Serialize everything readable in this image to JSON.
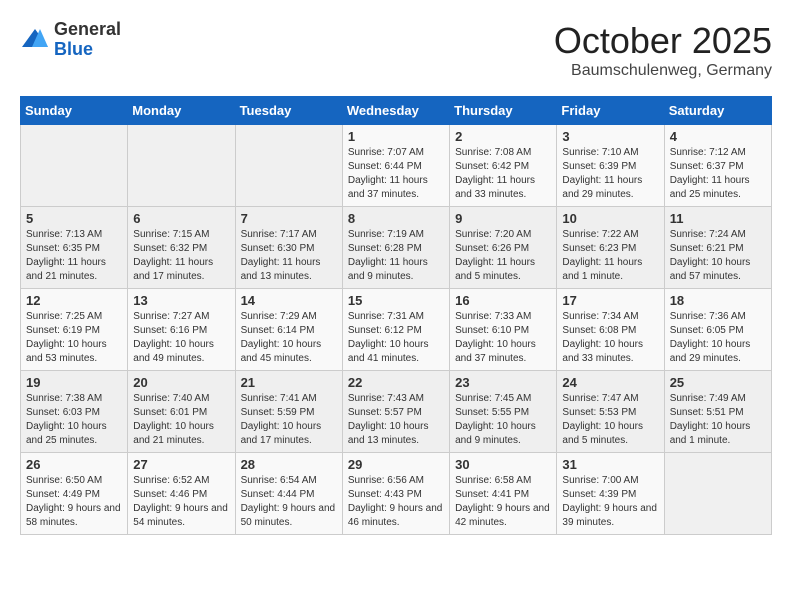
{
  "header": {
    "logo_general": "General",
    "logo_blue": "Blue",
    "title": "October 2025",
    "subtitle": "Baumschulenweg, Germany"
  },
  "days_of_week": [
    "Sunday",
    "Monday",
    "Tuesday",
    "Wednesday",
    "Thursday",
    "Friday",
    "Saturday"
  ],
  "weeks": [
    [
      {
        "day": "",
        "info": ""
      },
      {
        "day": "",
        "info": ""
      },
      {
        "day": "",
        "info": ""
      },
      {
        "day": "1",
        "info": "Sunrise: 7:07 AM\nSunset: 6:44 PM\nDaylight: 11 hours\nand 37 minutes."
      },
      {
        "day": "2",
        "info": "Sunrise: 7:08 AM\nSunset: 6:42 PM\nDaylight: 11 hours\nand 33 minutes."
      },
      {
        "day": "3",
        "info": "Sunrise: 7:10 AM\nSunset: 6:39 PM\nDaylight: 11 hours\nand 29 minutes."
      },
      {
        "day": "4",
        "info": "Sunrise: 7:12 AM\nSunset: 6:37 PM\nDaylight: 11 hours\nand 25 minutes."
      }
    ],
    [
      {
        "day": "5",
        "info": "Sunrise: 7:13 AM\nSunset: 6:35 PM\nDaylight: 11 hours\nand 21 minutes."
      },
      {
        "day": "6",
        "info": "Sunrise: 7:15 AM\nSunset: 6:32 PM\nDaylight: 11 hours\nand 17 minutes."
      },
      {
        "day": "7",
        "info": "Sunrise: 7:17 AM\nSunset: 6:30 PM\nDaylight: 11 hours\nand 13 minutes."
      },
      {
        "day": "8",
        "info": "Sunrise: 7:19 AM\nSunset: 6:28 PM\nDaylight: 11 hours\nand 9 minutes."
      },
      {
        "day": "9",
        "info": "Sunrise: 7:20 AM\nSunset: 6:26 PM\nDaylight: 11 hours\nand 5 minutes."
      },
      {
        "day": "10",
        "info": "Sunrise: 7:22 AM\nSunset: 6:23 PM\nDaylight: 11 hours\nand 1 minute."
      },
      {
        "day": "11",
        "info": "Sunrise: 7:24 AM\nSunset: 6:21 PM\nDaylight: 10 hours\nand 57 minutes."
      }
    ],
    [
      {
        "day": "12",
        "info": "Sunrise: 7:25 AM\nSunset: 6:19 PM\nDaylight: 10 hours\nand 53 minutes."
      },
      {
        "day": "13",
        "info": "Sunrise: 7:27 AM\nSunset: 6:16 PM\nDaylight: 10 hours\nand 49 minutes."
      },
      {
        "day": "14",
        "info": "Sunrise: 7:29 AM\nSunset: 6:14 PM\nDaylight: 10 hours\nand 45 minutes."
      },
      {
        "day": "15",
        "info": "Sunrise: 7:31 AM\nSunset: 6:12 PM\nDaylight: 10 hours\nand 41 minutes."
      },
      {
        "day": "16",
        "info": "Sunrise: 7:33 AM\nSunset: 6:10 PM\nDaylight: 10 hours\nand 37 minutes."
      },
      {
        "day": "17",
        "info": "Sunrise: 7:34 AM\nSunset: 6:08 PM\nDaylight: 10 hours\nand 33 minutes."
      },
      {
        "day": "18",
        "info": "Sunrise: 7:36 AM\nSunset: 6:05 PM\nDaylight: 10 hours\nand 29 minutes."
      }
    ],
    [
      {
        "day": "19",
        "info": "Sunrise: 7:38 AM\nSunset: 6:03 PM\nDaylight: 10 hours\nand 25 minutes."
      },
      {
        "day": "20",
        "info": "Sunrise: 7:40 AM\nSunset: 6:01 PM\nDaylight: 10 hours\nand 21 minutes."
      },
      {
        "day": "21",
        "info": "Sunrise: 7:41 AM\nSunset: 5:59 PM\nDaylight: 10 hours\nand 17 minutes."
      },
      {
        "day": "22",
        "info": "Sunrise: 7:43 AM\nSunset: 5:57 PM\nDaylight: 10 hours\nand 13 minutes."
      },
      {
        "day": "23",
        "info": "Sunrise: 7:45 AM\nSunset: 5:55 PM\nDaylight: 10 hours\nand 9 minutes."
      },
      {
        "day": "24",
        "info": "Sunrise: 7:47 AM\nSunset: 5:53 PM\nDaylight: 10 hours\nand 5 minutes."
      },
      {
        "day": "25",
        "info": "Sunrise: 7:49 AM\nSunset: 5:51 PM\nDaylight: 10 hours\nand 1 minute."
      }
    ],
    [
      {
        "day": "26",
        "info": "Sunrise: 6:50 AM\nSunset: 4:49 PM\nDaylight: 9 hours\nand 58 minutes."
      },
      {
        "day": "27",
        "info": "Sunrise: 6:52 AM\nSunset: 4:46 PM\nDaylight: 9 hours\nand 54 minutes."
      },
      {
        "day": "28",
        "info": "Sunrise: 6:54 AM\nSunset: 4:44 PM\nDaylight: 9 hours\nand 50 minutes."
      },
      {
        "day": "29",
        "info": "Sunrise: 6:56 AM\nSunset: 4:43 PM\nDaylight: 9 hours\nand 46 minutes."
      },
      {
        "day": "30",
        "info": "Sunrise: 6:58 AM\nSunset: 4:41 PM\nDaylight: 9 hours\nand 42 minutes."
      },
      {
        "day": "31",
        "info": "Sunrise: 7:00 AM\nSunset: 4:39 PM\nDaylight: 9 hours\nand 39 minutes."
      },
      {
        "day": "",
        "info": ""
      }
    ]
  ]
}
